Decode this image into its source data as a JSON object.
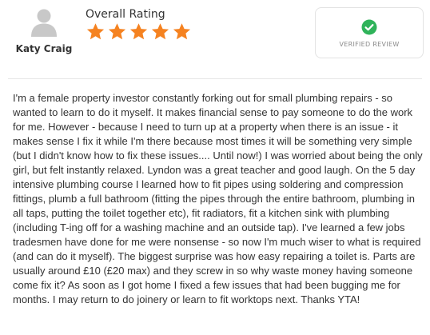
{
  "reviewer": {
    "name": "Katy Craig",
    "avatar_icon": "user-silhouette-icon"
  },
  "rating": {
    "label": "Overall Rating",
    "stars": 5,
    "max_stars": 5,
    "star_color": "#f58220"
  },
  "verified": {
    "icon": "check-circle-icon",
    "icon_color": "#2fb35a",
    "label": "VERIFIED REVIEW"
  },
  "review": {
    "text": "I'm a female property investor constantly forking out for small plumbing repairs - so wanted to learn to do it myself. It makes financial sense to pay someone to do the work for me. However - because I need to turn up at a property when there is an issue - it makes sense I fix it while I'm there because most times it will be something very simple (but I didn't know how to fix these issues.... Until now!) I was worried about being the only girl, but felt instantly relaxed. Lyndon was a great teacher and good laugh. On the 5 day intensive plumbing course I learned how to fit pipes using soldering and compression fittings, plumb a full bathroom (fitting the pipes through the entire bathroom, plumbing in all taps, putting the toilet together etc), fit radiators, fit a kitchen sink with plumbing (including T-ing off for a washing machine and an outside tap). I've learned a few jobs tradesmen have done for me were nonsense - so now I'm much wiser to what is required (and can do it myself). The biggest surprise was how easy repairing a toilet is. Parts are usually around £10 (£20 max) and they screw in so why waste money having someone come fix it? As soon as I got home I fixed a few issues that had been bugging me for months. I may return to do joinery or learn to fit worktops next. Thanks YTA!"
  }
}
